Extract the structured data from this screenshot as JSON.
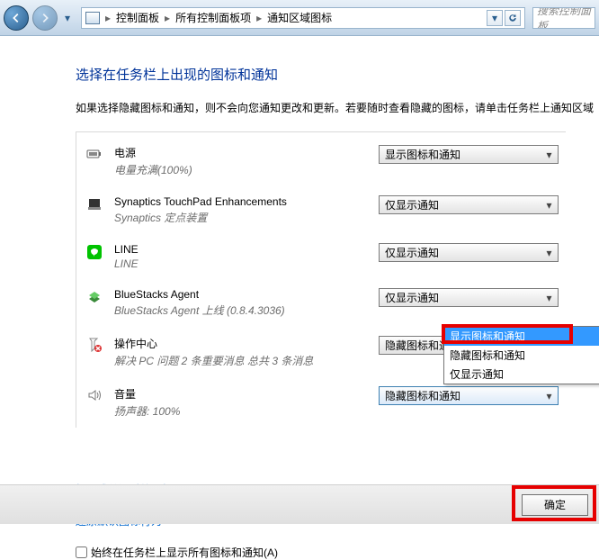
{
  "nav": {
    "crumbs": [
      "控制面板",
      "所有控制面板项",
      "通知区域图标"
    ],
    "search_placeholder": "搜索控制面板"
  },
  "page": {
    "title": "选择在任务栏上出现的图标和通知",
    "description": "如果选择隐藏图标和通知，则不会向您通知更改和更新。若要随时查看隐藏的图标，请单击任务栏上通知区域"
  },
  "items": [
    {
      "name": "电源",
      "status": "电量充满(100%)",
      "value": "显示图标和通知"
    },
    {
      "name": "Synaptics TouchPad Enhancements",
      "status": "Synaptics 定点装置",
      "value": "仅显示通知"
    },
    {
      "name": "LINE",
      "status": "LINE",
      "value": "仅显示通知"
    },
    {
      "name": "BlueStacks Agent",
      "status": "BlueStacks Agent 上线 (0.8.4.3036)",
      "value": "仅显示通知"
    },
    {
      "name": "操作中心",
      "status": "解决 PC 问题  2 条重要消息  总共 3 条消息",
      "value": "隐藏图标和通知"
    },
    {
      "name": "音量",
      "status": "扬声器: 100%",
      "value": "隐藏图标和通知"
    }
  ],
  "dropdown": {
    "options": [
      "显示图标和通知",
      "隐藏图标和通知",
      "仅显示通知"
    ],
    "selected": 0
  },
  "links": {
    "toggle_system": "打开或关闭系统图标",
    "restore_default": "还原默认图标行为"
  },
  "checkbox_label": "始终在任务栏上显示所有图标和通知(A)",
  "buttons": {
    "ok": "确定"
  }
}
